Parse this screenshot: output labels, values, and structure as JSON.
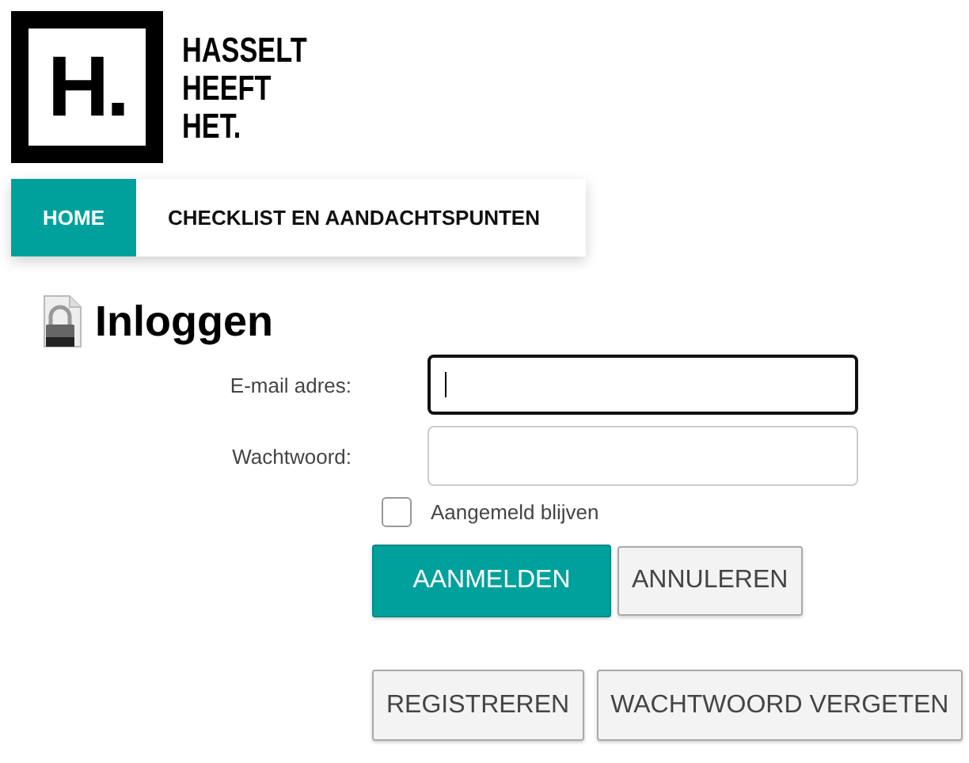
{
  "logo": {
    "mark": "H.",
    "lines": [
      "HASSELT",
      "HEEFT",
      "HET."
    ]
  },
  "nav": [
    {
      "label": "HOME",
      "selected": true
    },
    {
      "label": "CHECKLIST EN AANDACHTSPUNTEN",
      "selected": false
    }
  ],
  "heading": "Inloggen",
  "fields": [
    {
      "label": "E-mail adres:",
      "focused": true
    },
    {
      "label": "Wachtwoord:",
      "focused": false
    }
  ],
  "remember": {
    "label": "Aangemeld blijven",
    "checked": false
  },
  "buttons": [
    {
      "label": "AANMELDEN",
      "kind": "primary"
    },
    {
      "label": "ANNULEREN",
      "kind": "secondary"
    }
  ],
  "links": [
    {
      "label": "REGISTREREN"
    },
    {
      "label": "WACHTWOORD VERGETEN"
    }
  ]
}
